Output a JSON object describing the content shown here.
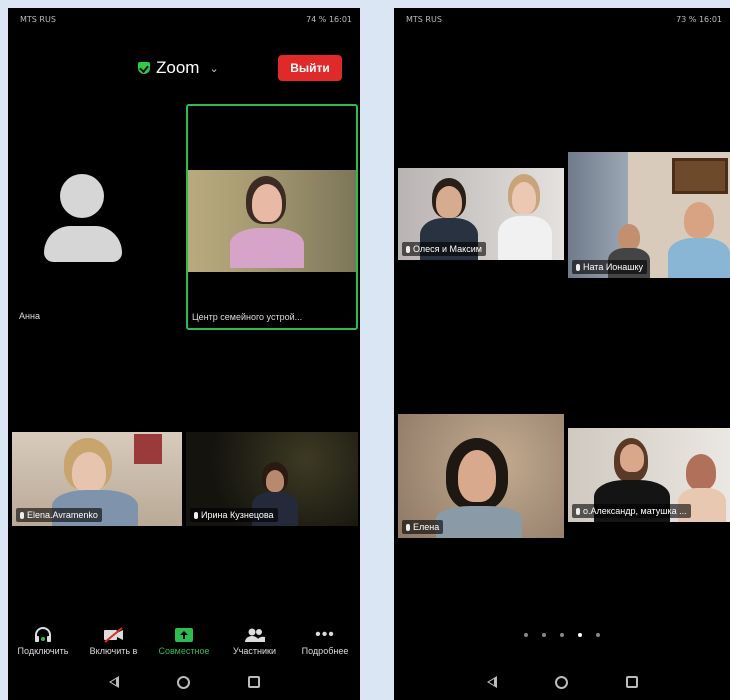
{
  "phone1": {
    "status_left": "MTS RUS",
    "status_right": "74 %  16:01",
    "meeting_title": "Zoom",
    "leave_label": "Выйти",
    "tiles": {
      "anna": "Анна",
      "center": "Центр семейного устрой...",
      "elena": "Elena.Avramenko",
      "irina": "Ирина Кузнецова"
    },
    "toolbar": [
      {
        "icon": "headphones-icon",
        "label": "Подключить"
      },
      {
        "icon": "video-off-icon",
        "label": "Включить в"
      },
      {
        "icon": "share-screen-icon",
        "label": "Совместное"
      },
      {
        "icon": "participants-icon",
        "label": "Участники"
      },
      {
        "icon": "more-icon",
        "label": "Подробнее"
      }
    ]
  },
  "phone2": {
    "status_left": "MTS RUS",
    "status_right": "73 %  16:01",
    "tiles": {
      "olesya": "Олеся и Максим",
      "nata": "Ната Ионашку",
      "elena": "Елена",
      "alexander": "о.Александр, матушка ..."
    },
    "page_dots": 5,
    "active_dot": 4
  },
  "colors": {
    "active_border": "#2dbd4e",
    "leave_button": "#e02a2a",
    "share_green": "#2dbd4e"
  }
}
